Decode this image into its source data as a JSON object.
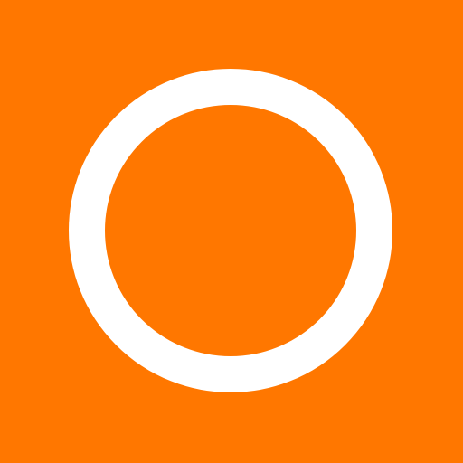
{
  "colors": {
    "background": "#FF7700",
    "ring": "#FFFFFF"
  },
  "icon": {
    "name": "ring-icon"
  }
}
